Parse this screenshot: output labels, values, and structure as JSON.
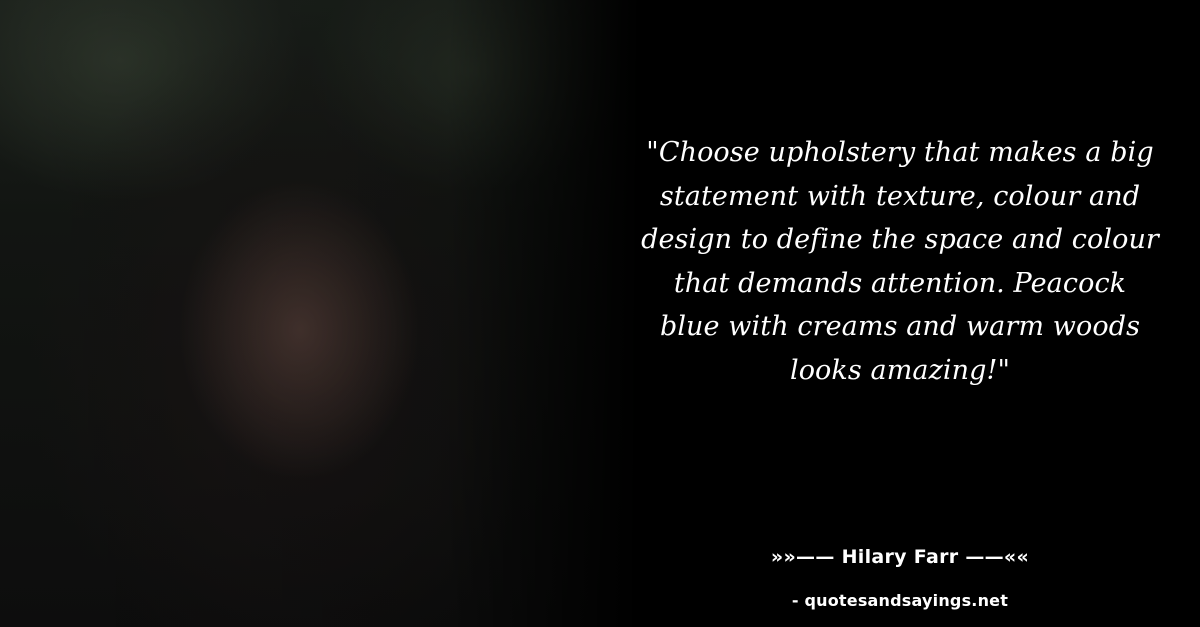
{
  "quote": {
    "text": "\"Choose upholstery that makes a big statement with texture, colour and design to define the space and colour that demands attention. Peacock blue with creams and warm woods looks amazing!\"",
    "author_line": "»»—— Hilary Farr ——««",
    "source_line": "- quotesandsayings.net"
  },
  "colors": {
    "background": "#000000",
    "text": "#ffffff"
  }
}
